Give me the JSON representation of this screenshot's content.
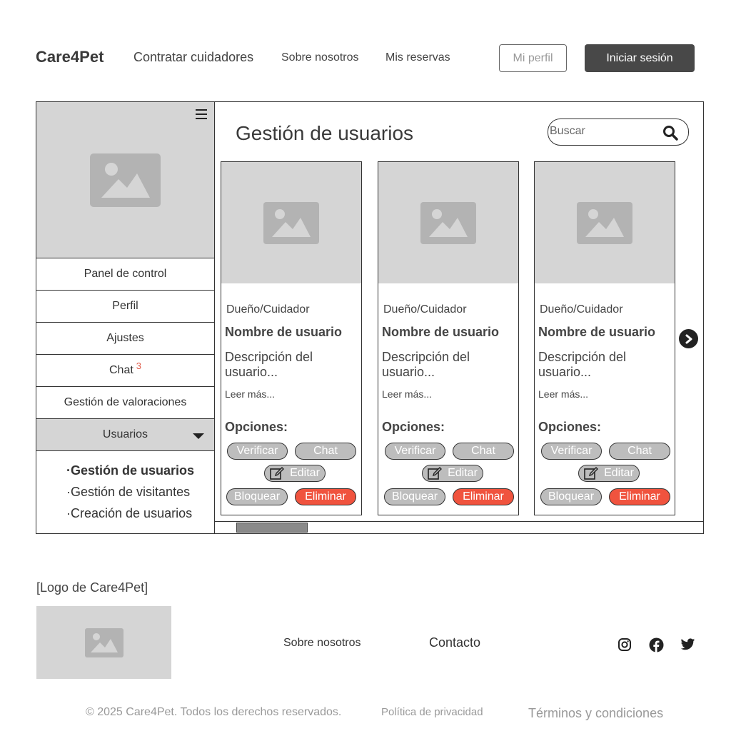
{
  "header": {
    "brand": "Care4Pet",
    "nav": [
      "Contratar cuidadores",
      "Sobre nosotros",
      "Mis reservas"
    ],
    "profile_button": "Mi perfil",
    "login_button": "Iniciar sesión"
  },
  "sidebar": {
    "items": [
      {
        "label": "Panel de control"
      },
      {
        "label": "Perfil"
      },
      {
        "label": "Ajustes"
      },
      {
        "label": "Chat",
        "badge": "3"
      },
      {
        "label": "Gestión de valoraciones"
      },
      {
        "label": "Usuarios"
      }
    ],
    "subitems": [
      "·Gestión de usuarios",
      "·Gestión de visitantes",
      "·Creación de usuarios"
    ]
  },
  "main": {
    "title": "Gestión de usuarios",
    "search_placeholder": "Buscar",
    "cards": [
      {
        "role": "Dueño/Cuidador",
        "name": "Nombre de usuario",
        "description": "Descripción del usuario...",
        "more": "Leer más...",
        "options_label": "Opciones:",
        "buttons": {
          "verify": "Verificar",
          "chat": "Chat",
          "edit": "Editar",
          "block": "Bloquear",
          "delete": "Eliminar"
        }
      },
      {
        "role": "Dueño/Cuidador",
        "name": "Nombre de usuario",
        "description": "Descripción del usuario...",
        "more": "Leer más...",
        "options_label": "Opciones:",
        "buttons": {
          "verify": "Verificar",
          "chat": "Chat",
          "edit": "Editar",
          "block": "Bloquear",
          "delete": "Eliminar"
        }
      },
      {
        "role": "Dueño/Cuidador",
        "name": "Nombre de usuario",
        "description": "Descripción del usuario...",
        "more": "Leer más...",
        "options_label": "Opciones:",
        "buttons": {
          "verify": "Verificar",
          "chat": "Chat",
          "edit": "Editar",
          "block": "Bloquear",
          "delete": "Eliminar"
        }
      }
    ]
  },
  "footer": {
    "logo_label": "[Logo de Care4Pet]",
    "links": [
      "Sobre nosotros",
      "Contacto"
    ],
    "social_icons": [
      "instagram-icon",
      "facebook-icon",
      "twitter-icon"
    ],
    "copyright": "© 2025 Care4Pet. Todos los derechos reservados.",
    "privacy": "Política de privacidad",
    "terms": "Términos y condiciones"
  },
  "colors": {
    "accent_dark": "#484848",
    "danger": "#f0533e",
    "placeholder_gray": "#d5d5d5",
    "pill_gray": "#bdbdbd"
  }
}
